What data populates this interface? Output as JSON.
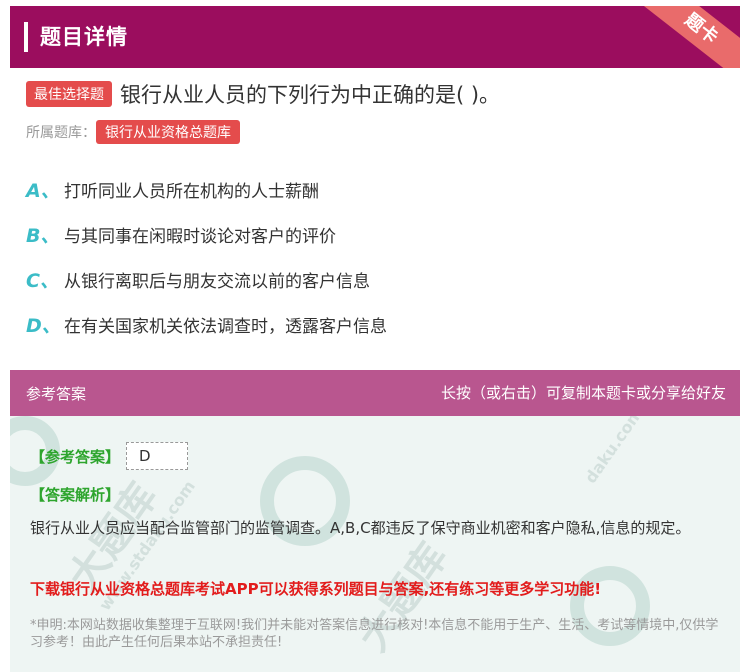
{
  "header": {
    "title": "题目详情",
    "corner": "题卡"
  },
  "question": {
    "tag": "最佳选择题",
    "text": "银行从业人员的下列行为中正确的是( )。",
    "bank_label": "所属题库：",
    "bank_name": "银行从业资格总题库"
  },
  "options": [
    {
      "letter": "A、",
      "text": "打听同业人员所在机构的人士薪酬"
    },
    {
      "letter": "B、",
      "text": "与其同事在闲暇时谈论对客户的评价"
    },
    {
      "letter": "C、",
      "text": "从银行离职后与朋友交流以前的客户信息"
    },
    {
      "letter": "D、",
      "text": "在有关国家机关依法调查时，透露客户信息"
    }
  ],
  "answer": {
    "head_left": "参考答案",
    "head_right": "长按（或右击）可复制本题卡或分享给好友",
    "ref_label": "【参考答案】",
    "ref_value": "D",
    "analysis_label": "【答案解析】",
    "analysis_text": "银行从业人员应当配合监管部门的监管调查。A,B,C都违反了保守商业机密和客户隐私,信息的规定。",
    "promo": "下载银行从业资格总题库考试APP可以获得系列题目与答案,还有练习等更多学习功能!",
    "note": "*申明:本网站数据收集整理于互联网!我们并未能对答案信息进行核对!本信息不能用于生产、生活、考试等情境中,仅供学习参考！由此产生任何后果本站不承担责任!"
  },
  "watermarks": [
    "大题库",
    "www.stdaku.com",
    "大题库",
    "daku.com"
  ],
  "colors": {
    "header": "#9b0d5e",
    "accent_red": "#e44c4c",
    "option_letter": "#3bbcc7",
    "answer_head": "#b9568f",
    "answer_body": "#eef5f3",
    "green": "#2ea52e",
    "promo_red": "#e21c1c"
  }
}
